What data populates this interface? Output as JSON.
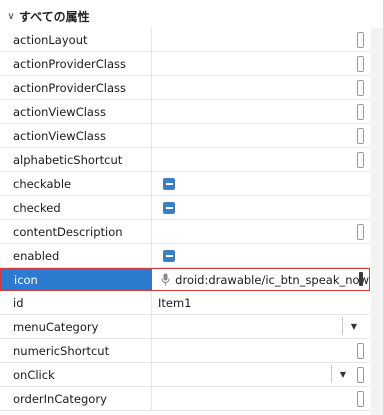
{
  "section": {
    "title": "すべての属性"
  },
  "properties": [
    {
      "name": "actionLayout",
      "value": "",
      "type": "text"
    },
    {
      "name": "actionProviderClass",
      "value": "",
      "type": "text"
    },
    {
      "name": "actionProviderClass",
      "value": "",
      "type": "text"
    },
    {
      "name": "actionViewClass",
      "value": "",
      "type": "text"
    },
    {
      "name": "actionViewClass",
      "value": "",
      "type": "text"
    },
    {
      "name": "alphabeticShortcut",
      "value": "",
      "type": "text"
    },
    {
      "name": "checkable",
      "value": "",
      "type": "checkbox"
    },
    {
      "name": "checked",
      "value": "",
      "type": "checkbox"
    },
    {
      "name": "contentDescription",
      "value": "",
      "type": "text"
    },
    {
      "name": "enabled",
      "value": "",
      "type": "checkbox"
    },
    {
      "name": "icon",
      "value": "droid:drawable/ic_btn_speak_now",
      "type": "icon",
      "selected": true
    },
    {
      "name": "id",
      "value": "Item1",
      "type": "plain"
    },
    {
      "name": "menuCategory",
      "value": "",
      "type": "dropdown"
    },
    {
      "name": "numericShortcut",
      "value": "",
      "type": "text"
    },
    {
      "name": "onClick",
      "value": "",
      "type": "dropdown-text"
    },
    {
      "name": "orderInCategory",
      "value": "",
      "type": "text"
    }
  ],
  "colors": {
    "selection": "#2d7bd0",
    "focus_border": "#d43a3a",
    "checkbox": "#3b7fc4"
  }
}
